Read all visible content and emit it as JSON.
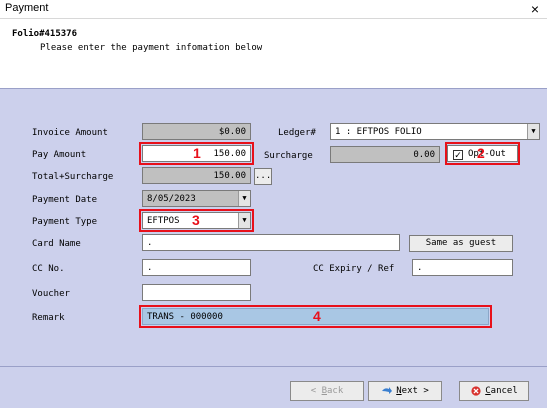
{
  "window": {
    "title": "Payment",
    "close_glyph": "×"
  },
  "header": {
    "folio": "Folio#415376",
    "instructions": "Please enter the payment infomation below"
  },
  "form": {
    "invoice_amount": {
      "label": "Invoice Amount",
      "value": "$0.00"
    },
    "ledger": {
      "label": "Ledger#",
      "value": "1 : EFTPOS FOLIO"
    },
    "pay_amount": {
      "label": "Pay Amount",
      "value": "150.00"
    },
    "surcharge": {
      "label": "Surcharge",
      "value": "0.00"
    },
    "opt_out": {
      "label": "Opt-Out",
      "checked": true
    },
    "total_surcharge": {
      "label": "Total+Surcharge",
      "value": "150.00",
      "button": "..."
    },
    "payment_date": {
      "label": "Payment Date",
      "value": "8/05/2023"
    },
    "payment_type": {
      "label": "Payment Type",
      "value": "EFTPOS"
    },
    "card_name": {
      "label": "Card Name",
      "value": ".",
      "button": "Same as guest"
    },
    "cc_no": {
      "label": "CC No.",
      "value": "."
    },
    "cc_expiry": {
      "label": "CC Expiry / Ref",
      "value": "."
    },
    "voucher": {
      "label": "Voucher",
      "value": ""
    },
    "remark": {
      "label": "Remark",
      "value": "TRANS - 000000"
    }
  },
  "annotations": {
    "n1": "1",
    "n2": "2",
    "n3": "3",
    "n4": "4"
  },
  "footer": {
    "back_prefix": "< ",
    "back_key": "B",
    "back_rest": "ack",
    "next_key": "N",
    "next_rest": "ext >",
    "cancel_key": "C",
    "cancel_rest": "ancel"
  },
  "colors": {
    "highlight": "#e8101a",
    "panel": "#ccd0ec",
    "remark_field": "#a9c7e4"
  },
  "icons": {
    "back": "arrow-left-icon",
    "next": "arrow-right-icon",
    "cancel": "cancel-circle-icon",
    "dropdown": "chevron-down-icon"
  }
}
